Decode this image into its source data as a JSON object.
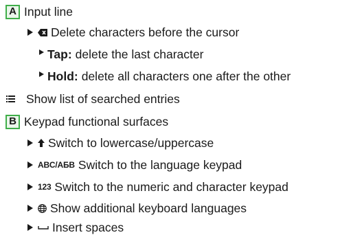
{
  "section_a": {
    "badge": "A",
    "title": "Input line",
    "delete_item": "Delete characters before the cursor",
    "tap_label": "Tap:",
    "tap_text": "delete the last character",
    "hold_label": "Hold:",
    "hold_text": "delete all characters one after the other"
  },
  "list_item": "Show list of searched entries",
  "section_b": {
    "badge": "B",
    "title": "Keypad functional surfaces",
    "shift_item": "Switch to lowercase/uppercase",
    "lang_key": "ABC/АБВ",
    "lang_item": "Switch to the language keypad",
    "num_key": "123",
    "num_item": "Switch to the numeric and character keypad",
    "globe_item": "Show additional keyboard languages",
    "space_item": "Insert spaces"
  },
  "icons": [
    "backspace-icon",
    "list-icon",
    "arrow-up-icon",
    "globe-icon",
    "space-bar-icon"
  ]
}
